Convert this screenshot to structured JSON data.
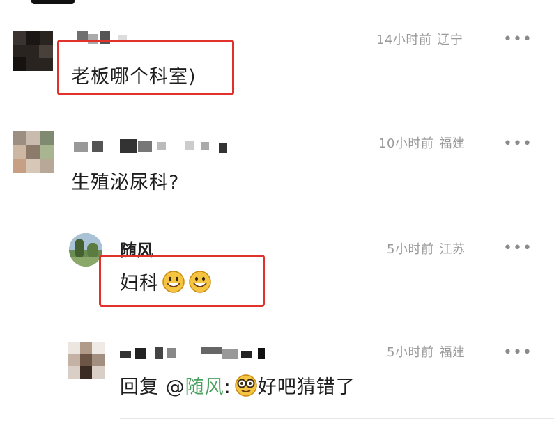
{
  "comments": [
    {
      "time": "14小时前",
      "location": "辽宁",
      "text": "老板哪个科室)"
    },
    {
      "time": "10小时前",
      "location": "福建",
      "text": "生殖泌尿科?"
    },
    {
      "username": "随风",
      "time": "5小时前",
      "location": "江苏",
      "text": "妇科",
      "emoji": "smiley-icon"
    },
    {
      "time": "5小时前",
      "location": "福建",
      "reply_prefix": "回复 @",
      "reply_to": "随风",
      "reply_colon": ":",
      "text": "好吧猜错了",
      "emoji": "nerd-glasses-icon"
    }
  ],
  "more_label": "•••",
  "colors": {
    "highlight": "#e0312a",
    "mention": "#4aa05f",
    "meta": "#9a9a9a"
  }
}
